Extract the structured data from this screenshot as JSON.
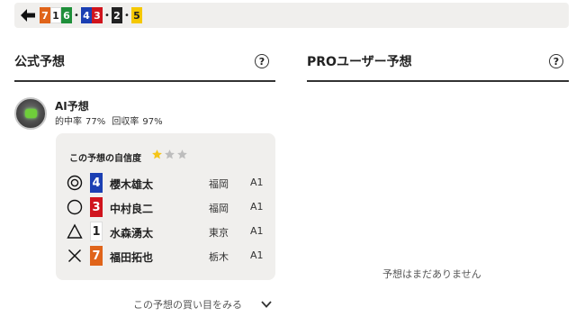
{
  "result_bar": {
    "boats": [
      {
        "num": "7",
        "color_class": "c7"
      },
      {
        "num": "1",
        "color_class": "c1"
      },
      {
        "num": "6",
        "color_class": "c6"
      },
      {
        "sep": "•"
      },
      {
        "num": "4",
        "color_class": "c4"
      },
      {
        "num": "3",
        "color_class": "c3"
      },
      {
        "sep": "•"
      },
      {
        "num": "2",
        "color_class": "c2"
      },
      {
        "sep": "•"
      },
      {
        "num": "5",
        "color_class": "c5"
      }
    ]
  },
  "official": {
    "title": "公式予想",
    "ai": {
      "name": "AI予想",
      "hit_label": "的中率",
      "hit_value": "77%",
      "return_label": "回収率",
      "return_value": "97%"
    },
    "confidence_label": "この予想の自信度",
    "confidence_stars": 1,
    "picks": [
      {
        "mark": "◎",
        "boat": "4",
        "color_class": "c4",
        "name": "櫻木雄太",
        "branch": "福岡",
        "class": "A1"
      },
      {
        "mark": "○",
        "boat": "3",
        "color_class": "c3",
        "name": "中村良二",
        "branch": "福岡",
        "class": "A1"
      },
      {
        "mark": "△",
        "boat": "1",
        "color_class": "c1",
        "name": "水森湧太",
        "branch": "東京",
        "class": "A1"
      },
      {
        "mark": "×",
        "boat": "7",
        "color_class": "c7",
        "name": "福田拓也",
        "branch": "栃木",
        "class": "A1"
      }
    ],
    "view_more": "この予想の買い目をみる"
  },
  "pro": {
    "title": "PROユーザー予想",
    "empty_message": "予想はまだありません"
  },
  "help_glyph": "?",
  "colors": {
    "star_on": "#f5c518",
    "star_off": "#bdbdbd",
    "panel_bg": "#f0efed"
  }
}
